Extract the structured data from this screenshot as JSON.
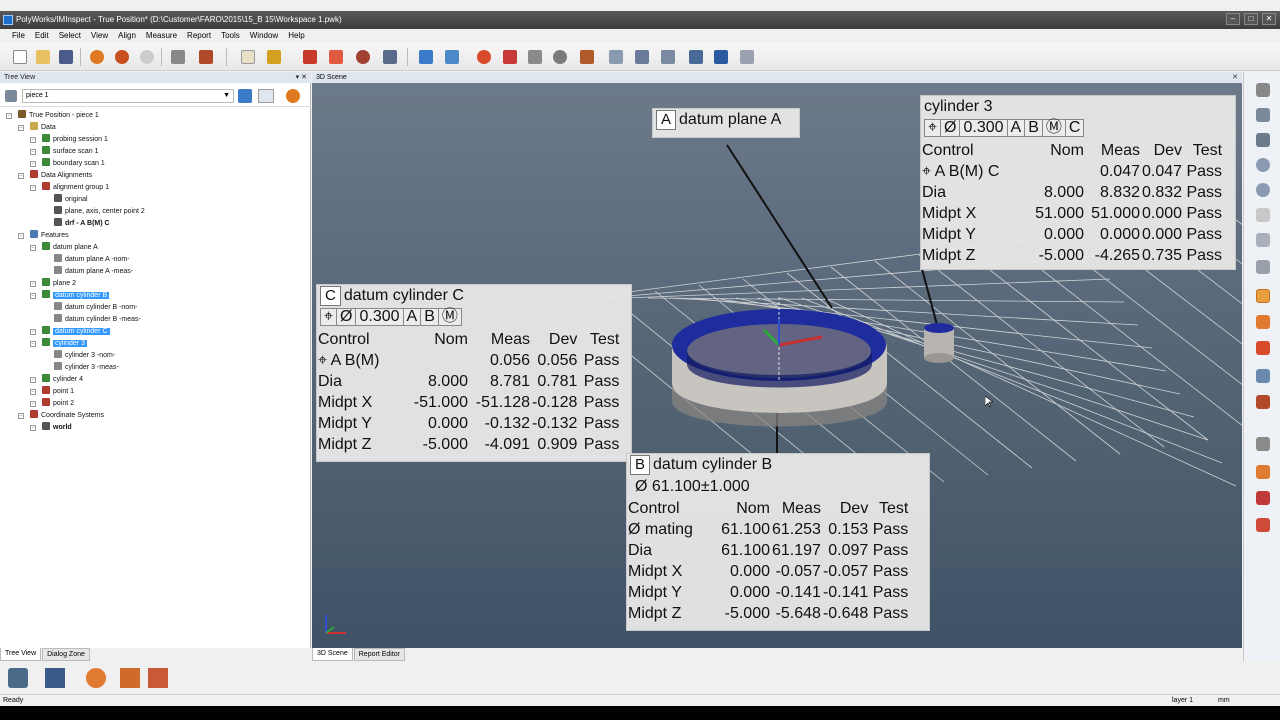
{
  "window": {
    "title": "PolyWorks/IMInspect - True Position* (D:\\Customer\\FARO\\2015\\15_B 15\\Workspace 1.pwk)"
  },
  "menu": [
    "File",
    "Edit",
    "Select",
    "View",
    "Align",
    "Measure",
    "Report",
    "Tools",
    "Window",
    "Help"
  ],
  "left_panel": {
    "title": "Tree View",
    "combo_value": "piece 1",
    "tree": [
      {
        "label": "True Position - piece 1",
        "level": 0,
        "icon": "piece-icon",
        "color": "#7a5a2a"
      },
      {
        "label": "Data",
        "level": 1,
        "icon": "folder-icon",
        "color": "#c9a94a"
      },
      {
        "label": "probing session 1",
        "level": 2,
        "icon": "probe-icon",
        "color": "#3a8a3a"
      },
      {
        "label": "surface scan 1",
        "level": 2,
        "icon": "scan-icon",
        "color": "#3a8a3a"
      },
      {
        "label": "boundary scan 1",
        "level": 2,
        "icon": "scan-icon",
        "color": "#3a8a3a"
      },
      {
        "label": "Data Alignments",
        "level": 1,
        "icon": "alignment-icon",
        "color": "#b03a2e"
      },
      {
        "label": "alignment group 1",
        "level": 2,
        "icon": "group-icon",
        "color": "#b03a2e"
      },
      {
        "label": "original",
        "level": 3,
        "icon": "axes-icon",
        "color": "#555"
      },
      {
        "label": "plane, axis, center point 2",
        "level": 3,
        "icon": "axes-icon",
        "color": "#555"
      },
      {
        "label": "drf - A B(M) C",
        "level": 3,
        "icon": "drf-icon",
        "color": "#555",
        "bold": true
      },
      {
        "label": "Features",
        "level": 1,
        "icon": "features-icon",
        "color": "#4a7ab0"
      },
      {
        "label": "datum plane A",
        "level": 2,
        "icon": "plane-icon",
        "color": "#3a8a3a"
      },
      {
        "label": "datum plane A -nom-",
        "level": 3,
        "icon": "doc-icon",
        "color": "#888"
      },
      {
        "label": "datum plane A -meas-",
        "level": 3,
        "icon": "doc-icon",
        "color": "#888"
      },
      {
        "label": "plane 2",
        "level": 2,
        "icon": "plane-icon",
        "color": "#3a8a3a"
      },
      {
        "label": "datum cylinder B",
        "level": 2,
        "icon": "cylinder-icon",
        "color": "#3a8a3a",
        "selected": true
      },
      {
        "label": "datum cylinder B -nom-",
        "level": 3,
        "icon": "doc-icon",
        "color": "#888"
      },
      {
        "label": "datum cylinder B -meas-",
        "level": 3,
        "icon": "doc-icon",
        "color": "#888"
      },
      {
        "label": "datum cylinder C",
        "level": 2,
        "icon": "cylinder-icon",
        "color": "#3a8a3a",
        "selected": true
      },
      {
        "label": "cylinder 3",
        "level": 2,
        "icon": "cylinder-icon",
        "color": "#3a8a3a",
        "selected": true
      },
      {
        "label": "cylinder 3 -nom-",
        "level": 3,
        "icon": "doc-icon",
        "color": "#888"
      },
      {
        "label": "cylinder 3 -meas-",
        "level": 3,
        "icon": "doc-icon",
        "color": "#888"
      },
      {
        "label": "cylinder 4",
        "level": 2,
        "icon": "cylinder-icon",
        "color": "#3a8a3a"
      },
      {
        "label": "point 1",
        "level": 2,
        "icon": "point-icon",
        "color": "#b03a2e"
      },
      {
        "label": "point 2",
        "level": 2,
        "icon": "point-icon",
        "color": "#b03a2e"
      },
      {
        "label": "Coordinate Systems",
        "level": 1,
        "icon": "coord-icon",
        "color": "#b03a2e"
      },
      {
        "label": "world",
        "level": 2,
        "icon": "world-icon",
        "color": "#555",
        "bold": true
      }
    ],
    "tabs": [
      "Tree View",
      "Dialog Zone"
    ]
  },
  "scene": {
    "title": "3D Scene",
    "tabs": [
      "3D Scene",
      "Report Editor"
    ]
  },
  "callouts": {
    "plane_a": {
      "letter": "A",
      "title": "datum plane A"
    },
    "cyl3": {
      "title": "cylinder 3",
      "fcf": [
        "⌖",
        "Ø",
        "0.300",
        "A",
        "B",
        "Ⓜ",
        "C"
      ],
      "headers": [
        "Control",
        "Nom",
        "Meas",
        "Dev",
        "Test"
      ],
      "rows": [
        [
          "⌖  A B(M) C",
          "",
          "0.047",
          "0.047",
          "Pass"
        ],
        [
          "Dia",
          "8.000",
          "8.832",
          "0.832",
          "Pass"
        ],
        [
          "Midpt X",
          "51.000",
          "51.000",
          "0.000",
          "Pass"
        ],
        [
          "Midpt Y",
          "0.000",
          "0.000",
          "0.000",
          "Pass"
        ],
        [
          "Midpt Z",
          "-5.000",
          "-4.265",
          "0.735",
          "Pass"
        ]
      ]
    },
    "cyl_c": {
      "letter": "C",
      "title": "datum cylinder C",
      "fcf": [
        "⌖",
        "Ø",
        "0.300",
        "A",
        "B",
        "Ⓜ"
      ],
      "headers": [
        "Control",
        "Nom",
        "Meas",
        "Dev",
        "Test"
      ],
      "rows": [
        [
          "⌖  A B(M)",
          "",
          "0.056",
          "0.056",
          "Pass"
        ],
        [
          "Dia",
          "8.000",
          "8.781",
          "0.781",
          "Pass"
        ],
        [
          "Midpt X",
          "-51.000",
          "-51.128",
          "-0.128",
          "Pass"
        ],
        [
          "Midpt Y",
          "0.000",
          "-0.132",
          "-0.132",
          "Pass"
        ],
        [
          "Midpt Z",
          "-5.000",
          "-4.091",
          "0.909",
          "Pass"
        ]
      ]
    },
    "cyl_b": {
      "letter": "B",
      "title": "datum cylinder B",
      "fcf_text": "Ø  61.100±1.000",
      "headers": [
        "Control",
        "Nom",
        "Meas",
        "Dev",
        "Test"
      ],
      "rows": [
        [
          "Ø  mating",
          "61.100",
          "61.253",
          "0.153",
          "Pass"
        ],
        [
          "Dia",
          "61.100",
          "61.197",
          "0.097",
          "Pass"
        ],
        [
          "Midpt X",
          "0.000",
          "-0.057",
          "-0.057",
          "Pass"
        ],
        [
          "Midpt Y",
          "0.000",
          "-0.141",
          "-0.141",
          "Pass"
        ],
        [
          "Midpt Z",
          "-5.000",
          "-5.648",
          "-0.648",
          "Pass"
        ]
      ]
    }
  },
  "status": {
    "left": "Ready",
    "layer": "layer 1",
    "units": "mm"
  },
  "colors": {
    "selection": "#3399ff",
    "ring_blue": "#1f2fa8",
    "ring_gray": "#a8a4a0",
    "grid": "#dcdcdc"
  }
}
